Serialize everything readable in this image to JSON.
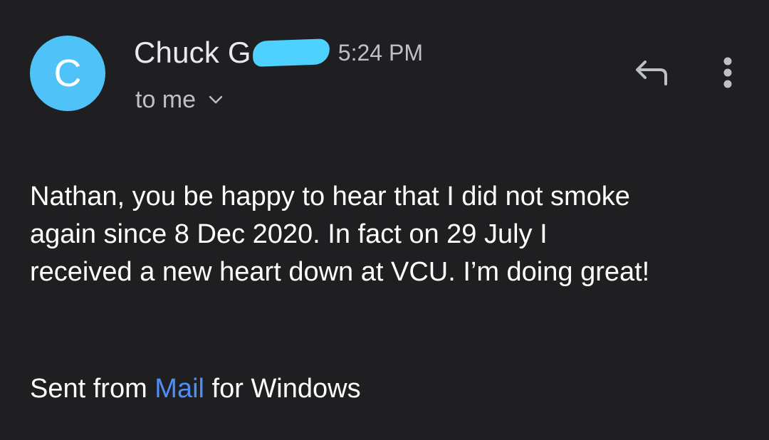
{
  "sender": {
    "avatar_letter": "C",
    "avatar_color": "#4fc3f7",
    "name_visible": "Chuck G",
    "redaction_color": "#4fd1ff",
    "time": "5:24 PM"
  },
  "recipient": {
    "label": "to me",
    "chevron_icon": "chevron-down-icon"
  },
  "actions": {
    "reply_icon": "reply-icon",
    "more_icon": "more-vertical-icon"
  },
  "message": {
    "body_lines": [
      "Nathan, you be happy to hear that I did not smoke",
      "again since 8 Dec 2020.  In fact on 29 July I",
      "received a new heart down at VCU.  I’m doing great!"
    ],
    "signature": {
      "prefix": "Sent from ",
      "link_text": "Mail",
      "suffix": " for Windows",
      "link_color": "#4f8ef7"
    }
  }
}
